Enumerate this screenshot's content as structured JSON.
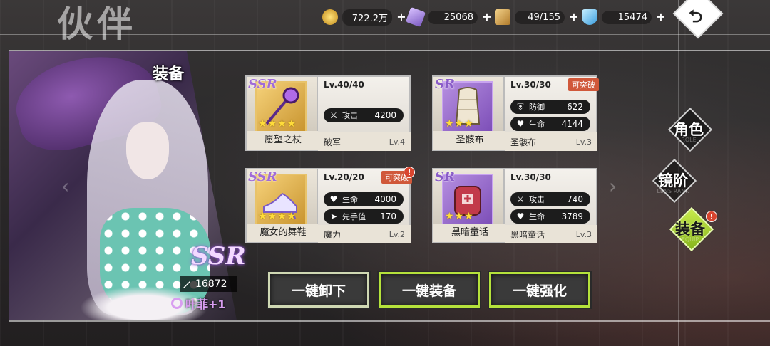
{
  "header": {
    "title": "伙伴",
    "resources": [
      {
        "icon": "gold-coin-icon",
        "value": "722.2万"
      },
      {
        "icon": "purple-crystal-icon",
        "value": "25068"
      },
      {
        "icon": "supply-box-icon",
        "value": "49/155"
      },
      {
        "icon": "diamond-icon",
        "value": "15474"
      }
    ],
    "plus": "+",
    "back_icon": "back-arrow-icon",
    "back_glyph": "⮌"
  },
  "character": {
    "section_title": "装备",
    "rarity": "SSR",
    "power": "16872",
    "name": "叶菲+1"
  },
  "equipment": [
    {
      "rarity": "SSR",
      "stars": "★★★★",
      "item_name": "愿望之杖",
      "level": "Lv.40/40",
      "break": "",
      "has_alert": false,
      "stats": [
        {
          "icon": "sword-icon",
          "glyph": "⚔",
          "label": "攻击",
          "value": "4200"
        }
      ],
      "set_name": "破军",
      "set_level": "Lv.4"
    },
    {
      "rarity": "SR",
      "stars": "★★★",
      "item_name": "圣骸布",
      "level": "Lv.30/30",
      "break": "可突破",
      "has_alert": false,
      "stats": [
        {
          "icon": "shield-icon",
          "glyph": "⛨",
          "label": "防御",
          "value": "622"
        },
        {
          "icon": "heart-icon",
          "glyph": "♥",
          "label": "生命",
          "value": "4144"
        }
      ],
      "set_name": "圣骸布",
      "set_level": "Lv.3"
    },
    {
      "rarity": "SSR",
      "stars": "★★★★",
      "item_name": "魔女的舞鞋",
      "level": "Lv.20/20",
      "break": "可突破",
      "has_alert": true,
      "stats": [
        {
          "icon": "heart-icon",
          "glyph": "♥",
          "label": "生命",
          "value": "4000"
        },
        {
          "icon": "speed-icon",
          "glyph": "➤",
          "label": "先手值",
          "value": "170"
        }
      ],
      "set_name": "魔力",
      "set_level": "Lv.2"
    },
    {
      "rarity": "SR",
      "stars": "★★★",
      "item_name": "黑暗童话",
      "level": "Lv.30/30",
      "break": "",
      "has_alert": false,
      "stats": [
        {
          "icon": "sword-icon",
          "glyph": "⚔",
          "label": "攻击",
          "value": "740"
        },
        {
          "icon": "heart-icon",
          "glyph": "♥",
          "label": "生命",
          "value": "3789"
        }
      ],
      "set_name": "黑暗童话",
      "set_level": "Lv.3"
    }
  ],
  "actions": {
    "unequip_all": "一键卸下",
    "equip_all": "一键装备",
    "enhance_all": "一键强化"
  },
  "tabs": [
    {
      "label": "角色",
      "sub": "ROLE",
      "active": false
    },
    {
      "label": "镜阶",
      "sub": "LENS RANK",
      "active": false
    },
    {
      "label": "装备",
      "sub": "EQUIP",
      "active": true
    }
  ],
  "alert_glyph": "!",
  "colors": {
    "accent_lime": "#b5e23b",
    "break_badge": "#d0583a",
    "alert_red": "#d8452f",
    "ssr_gold": "#c99530",
    "sr_purple": "#7d4fb8"
  }
}
